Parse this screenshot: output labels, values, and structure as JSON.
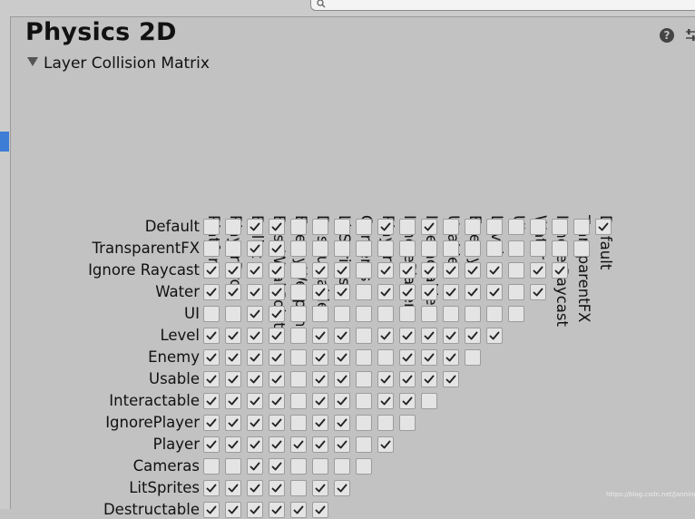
{
  "header": {
    "title": "Physics 2D",
    "help_icon": "help-icon",
    "settings_icon": "preset-settings-icon"
  },
  "matrix": {
    "foldout_label": "Layer Collision Matrix",
    "foldout_state": "expanded",
    "columns": [
      "Platform",
      "PlayerDrop",
      "Bullet",
      "BossWeakPoint",
      "EnemyWeapon",
      "Destructable",
      "LitSprites",
      "Cameras",
      "Player",
      "IgnorePlayer",
      "Interactable",
      "Usable",
      "Enemy",
      "Level",
      "UI",
      "Water",
      "Ignore Raycast",
      "TransparentFX",
      "Default"
    ],
    "rows": [
      {
        "label": "Default",
        "checks": [
          0,
          0,
          1,
          1,
          0,
          0,
          0,
          0,
          1,
          0,
          1,
          0,
          0,
          0,
          0,
          0,
          0,
          0,
          1
        ]
      },
      {
        "label": "TransparentFX",
        "checks": [
          0,
          0,
          1,
          1,
          0,
          0,
          0,
          0,
          0,
          0,
          0,
          0,
          0,
          0,
          0,
          0,
          0,
          0
        ]
      },
      {
        "label": "Ignore Raycast",
        "checks": [
          1,
          1,
          1,
          1,
          0,
          1,
          1,
          0,
          1,
          1,
          1,
          1,
          1,
          1,
          0,
          1,
          1
        ]
      },
      {
        "label": "Water",
        "checks": [
          1,
          1,
          1,
          1,
          0,
          1,
          1,
          0,
          1,
          1,
          1,
          1,
          1,
          1,
          0,
          1
        ]
      },
      {
        "label": "UI",
        "checks": [
          0,
          0,
          1,
          1,
          0,
          0,
          0,
          0,
          0,
          0,
          0,
          0,
          0,
          0,
          0
        ]
      },
      {
        "label": "Level",
        "checks": [
          1,
          1,
          1,
          1,
          0,
          1,
          1,
          0,
          1,
          1,
          1,
          1,
          1,
          1
        ]
      },
      {
        "label": "Enemy",
        "checks": [
          1,
          1,
          1,
          1,
          0,
          1,
          1,
          0,
          0,
          1,
          1,
          1,
          0
        ]
      },
      {
        "label": "Usable",
        "checks": [
          1,
          1,
          1,
          1,
          0,
          1,
          1,
          0,
          1,
          1,
          1,
          1
        ]
      },
      {
        "label": "Interactable",
        "checks": [
          1,
          1,
          1,
          1,
          0,
          1,
          1,
          0,
          1,
          1,
          0
        ]
      },
      {
        "label": "IgnorePlayer",
        "checks": [
          1,
          1,
          1,
          1,
          0,
          1,
          1,
          0,
          0,
          0
        ]
      },
      {
        "label": "Player",
        "checks": [
          1,
          1,
          1,
          1,
          1,
          1,
          1,
          0,
          1
        ]
      },
      {
        "label": "Cameras",
        "checks": [
          0,
          0,
          1,
          1,
          0,
          0,
          0,
          0
        ]
      },
      {
        "label": "LitSprites",
        "checks": [
          1,
          1,
          1,
          1,
          0,
          1,
          1
        ]
      },
      {
        "label": "Destructable",
        "checks": [
          1,
          1,
          1,
          1,
          1,
          1
        ]
      }
    ]
  },
  "watermark": "https://blog.csdn.net/JanningStar",
  "colors": {
    "background": "#c2c2c2",
    "checkbox_fill": "#e4e4e4",
    "selection_blue": "#3d7dd6"
  }
}
